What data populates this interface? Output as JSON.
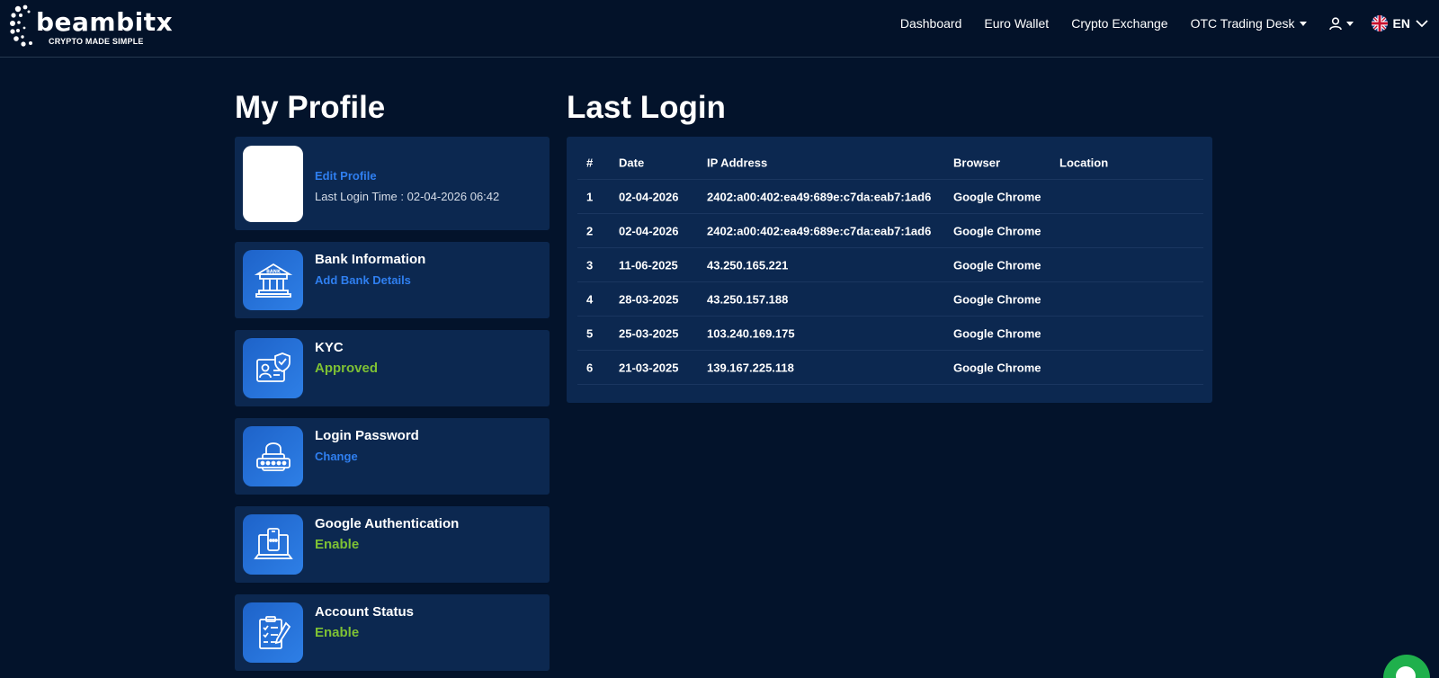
{
  "brand": {
    "name": "beambitx",
    "tagline": "CRYPTO MADE SIMPLE"
  },
  "nav": {
    "items": [
      "Dashboard",
      "Euro Wallet",
      "Crypto Exchange",
      "OTC Trading Desk"
    ],
    "language": "EN"
  },
  "profile": {
    "heading": "My Profile",
    "edit_link": "Edit Profile",
    "last_login_time": "Last Login Time : 02-04-2026 06:42",
    "cards": [
      {
        "title": "Bank Information",
        "value": "Add Bank Details",
        "icon": "bank-icon"
      },
      {
        "title": "KYC",
        "value": "Approved",
        "icon": "id-card-shield-icon"
      },
      {
        "title": "Login Password",
        "value": "Change",
        "icon": "padlock-icon"
      },
      {
        "title": "Google Authentication",
        "value": "Enable",
        "icon": "mobile-laptop-icon"
      },
      {
        "title": "Account Status",
        "value": "Enable",
        "icon": "checklist-icon"
      }
    ]
  },
  "last_login": {
    "heading": "Last Login",
    "columns": [
      "#",
      "Date",
      "IP Address",
      "Browser",
      "Location"
    ],
    "rows": [
      [
        "1",
        "02-04-2026",
        "2402:a00:402:ea49:689e:c7da:eab7:1ad6",
        "Google Chrome",
        ""
      ],
      [
        "2",
        "02-04-2026",
        "2402:a00:402:ea49:689e:c7da:eab7:1ad6",
        "Google Chrome",
        ""
      ],
      [
        "3",
        "11-06-2025",
        "43.250.165.221",
        "Google Chrome",
        ""
      ],
      [
        "4",
        "28-03-2025",
        "43.250.157.188",
        "Google Chrome",
        ""
      ],
      [
        "5",
        "25-03-2025",
        "103.240.169.175",
        "Google Chrome",
        ""
      ],
      [
        "6",
        "21-03-2025",
        "139.167.225.118",
        "Google Chrome",
        ""
      ]
    ]
  },
  "colors": {
    "background": "#03132b",
    "card": "#0c2850",
    "link_blue": "#2f7ff0",
    "success_green": "#7ec134",
    "chat_green": "#1fb04c"
  }
}
